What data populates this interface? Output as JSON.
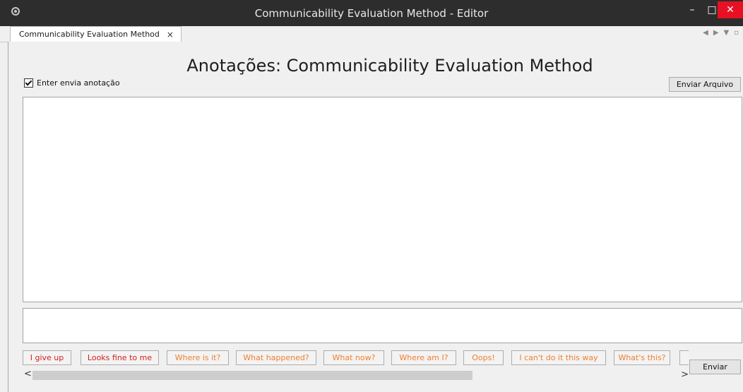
{
  "window": {
    "title": "Communicability Evaluation Method - Editor",
    "controls": {
      "minimize": "–",
      "maximize": "□",
      "close": "✕"
    }
  },
  "tabs": [
    {
      "label": "Communicability Evaluation Method",
      "close": "×"
    }
  ],
  "tab_nav": {
    "back": "◀",
    "forward": "▶",
    "menu": "▼",
    "extra": "▫"
  },
  "page": {
    "heading": "Anotações: Communicability Evaluation Method",
    "enter_checkbox": {
      "label": "Enter envia anotação",
      "checked": true
    },
    "send_file_button": "Enviar Arquivo",
    "send_button": "Enviar"
  },
  "tags": [
    {
      "label": "I give up",
      "color": "#d21f1f"
    },
    {
      "label": "Looks fine to me",
      "color": "#d21f1f"
    },
    {
      "label": "Where is it?",
      "color": "#f07f2f"
    },
    {
      "label": "What happened?",
      "color": "#f07f2f"
    },
    {
      "label": "What now?",
      "color": "#f07f2f"
    },
    {
      "label": "Where am I?",
      "color": "#f07f2f"
    },
    {
      "label": "Oops!",
      "color": "#f07f2f"
    },
    {
      "label": "I can't do it this way",
      "color": "#f07f2f"
    },
    {
      "label": "What's this?",
      "color": "#f07f2f"
    }
  ],
  "scroll": {
    "left": "<",
    "right": ">"
  }
}
